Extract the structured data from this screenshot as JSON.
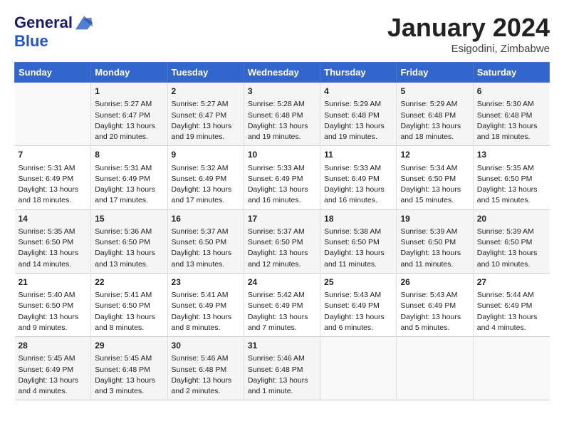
{
  "logo": {
    "line1": "General",
    "line2": "Blue"
  },
  "header": {
    "month": "January 2024",
    "location": "Esigodini, Zimbabwe"
  },
  "columns": [
    "Sunday",
    "Monday",
    "Tuesday",
    "Wednesday",
    "Thursday",
    "Friday",
    "Saturday"
  ],
  "weeks": [
    [
      {
        "day": "",
        "sunrise": "",
        "sunset": "",
        "daylight": ""
      },
      {
        "day": "1",
        "sunrise": "Sunrise: 5:27 AM",
        "sunset": "Sunset: 6:47 PM",
        "daylight": "Daylight: 13 hours and 20 minutes."
      },
      {
        "day": "2",
        "sunrise": "Sunrise: 5:27 AM",
        "sunset": "Sunset: 6:47 PM",
        "daylight": "Daylight: 13 hours and 19 minutes."
      },
      {
        "day": "3",
        "sunrise": "Sunrise: 5:28 AM",
        "sunset": "Sunset: 6:48 PM",
        "daylight": "Daylight: 13 hours and 19 minutes."
      },
      {
        "day": "4",
        "sunrise": "Sunrise: 5:29 AM",
        "sunset": "Sunset: 6:48 PM",
        "daylight": "Daylight: 13 hours and 19 minutes."
      },
      {
        "day": "5",
        "sunrise": "Sunrise: 5:29 AM",
        "sunset": "Sunset: 6:48 PM",
        "daylight": "Daylight: 13 hours and 18 minutes."
      },
      {
        "day": "6",
        "sunrise": "Sunrise: 5:30 AM",
        "sunset": "Sunset: 6:48 PM",
        "daylight": "Daylight: 13 hours and 18 minutes."
      }
    ],
    [
      {
        "day": "7",
        "sunrise": "Sunrise: 5:31 AM",
        "sunset": "Sunset: 6:49 PM",
        "daylight": "Daylight: 13 hours and 18 minutes."
      },
      {
        "day": "8",
        "sunrise": "Sunrise: 5:31 AM",
        "sunset": "Sunset: 6:49 PM",
        "daylight": "Daylight: 13 hours and 17 minutes."
      },
      {
        "day": "9",
        "sunrise": "Sunrise: 5:32 AM",
        "sunset": "Sunset: 6:49 PM",
        "daylight": "Daylight: 13 hours and 17 minutes."
      },
      {
        "day": "10",
        "sunrise": "Sunrise: 5:33 AM",
        "sunset": "Sunset: 6:49 PM",
        "daylight": "Daylight: 13 hours and 16 minutes."
      },
      {
        "day": "11",
        "sunrise": "Sunrise: 5:33 AM",
        "sunset": "Sunset: 6:49 PM",
        "daylight": "Daylight: 13 hours and 16 minutes."
      },
      {
        "day": "12",
        "sunrise": "Sunrise: 5:34 AM",
        "sunset": "Sunset: 6:50 PM",
        "daylight": "Daylight: 13 hours and 15 minutes."
      },
      {
        "day": "13",
        "sunrise": "Sunrise: 5:35 AM",
        "sunset": "Sunset: 6:50 PM",
        "daylight": "Daylight: 13 hours and 15 minutes."
      }
    ],
    [
      {
        "day": "14",
        "sunrise": "Sunrise: 5:35 AM",
        "sunset": "Sunset: 6:50 PM",
        "daylight": "Daylight: 13 hours and 14 minutes."
      },
      {
        "day": "15",
        "sunrise": "Sunrise: 5:36 AM",
        "sunset": "Sunset: 6:50 PM",
        "daylight": "Daylight: 13 hours and 13 minutes."
      },
      {
        "day": "16",
        "sunrise": "Sunrise: 5:37 AM",
        "sunset": "Sunset: 6:50 PM",
        "daylight": "Daylight: 13 hours and 13 minutes."
      },
      {
        "day": "17",
        "sunrise": "Sunrise: 5:37 AM",
        "sunset": "Sunset: 6:50 PM",
        "daylight": "Daylight: 13 hours and 12 minutes."
      },
      {
        "day": "18",
        "sunrise": "Sunrise: 5:38 AM",
        "sunset": "Sunset: 6:50 PM",
        "daylight": "Daylight: 13 hours and 11 minutes."
      },
      {
        "day": "19",
        "sunrise": "Sunrise: 5:39 AM",
        "sunset": "Sunset: 6:50 PM",
        "daylight": "Daylight: 13 hours and 11 minutes."
      },
      {
        "day": "20",
        "sunrise": "Sunrise: 5:39 AM",
        "sunset": "Sunset: 6:50 PM",
        "daylight": "Daylight: 13 hours and 10 minutes."
      }
    ],
    [
      {
        "day": "21",
        "sunrise": "Sunrise: 5:40 AM",
        "sunset": "Sunset: 6:50 PM",
        "daylight": "Daylight: 13 hours and 9 minutes."
      },
      {
        "day": "22",
        "sunrise": "Sunrise: 5:41 AM",
        "sunset": "Sunset: 6:50 PM",
        "daylight": "Daylight: 13 hours and 8 minutes."
      },
      {
        "day": "23",
        "sunrise": "Sunrise: 5:41 AM",
        "sunset": "Sunset: 6:49 PM",
        "daylight": "Daylight: 13 hours and 8 minutes."
      },
      {
        "day": "24",
        "sunrise": "Sunrise: 5:42 AM",
        "sunset": "Sunset: 6:49 PM",
        "daylight": "Daylight: 13 hours and 7 minutes."
      },
      {
        "day": "25",
        "sunrise": "Sunrise: 5:43 AM",
        "sunset": "Sunset: 6:49 PM",
        "daylight": "Daylight: 13 hours and 6 minutes."
      },
      {
        "day": "26",
        "sunrise": "Sunrise: 5:43 AM",
        "sunset": "Sunset: 6:49 PM",
        "daylight": "Daylight: 13 hours and 5 minutes."
      },
      {
        "day": "27",
        "sunrise": "Sunrise: 5:44 AM",
        "sunset": "Sunset: 6:49 PM",
        "daylight": "Daylight: 13 hours and 4 minutes."
      }
    ],
    [
      {
        "day": "28",
        "sunrise": "Sunrise: 5:45 AM",
        "sunset": "Sunset: 6:49 PM",
        "daylight": "Daylight: 13 hours and 4 minutes."
      },
      {
        "day": "29",
        "sunrise": "Sunrise: 5:45 AM",
        "sunset": "Sunset: 6:48 PM",
        "daylight": "Daylight: 13 hours and 3 minutes."
      },
      {
        "day": "30",
        "sunrise": "Sunrise: 5:46 AM",
        "sunset": "Sunset: 6:48 PM",
        "daylight": "Daylight: 13 hours and 2 minutes."
      },
      {
        "day": "31",
        "sunrise": "Sunrise: 5:46 AM",
        "sunset": "Sunset: 6:48 PM",
        "daylight": "Daylight: 13 hours and 1 minute."
      },
      {
        "day": "",
        "sunrise": "",
        "sunset": "",
        "daylight": ""
      },
      {
        "day": "",
        "sunrise": "",
        "sunset": "",
        "daylight": ""
      },
      {
        "day": "",
        "sunrise": "",
        "sunset": "",
        "daylight": ""
      }
    ]
  ]
}
